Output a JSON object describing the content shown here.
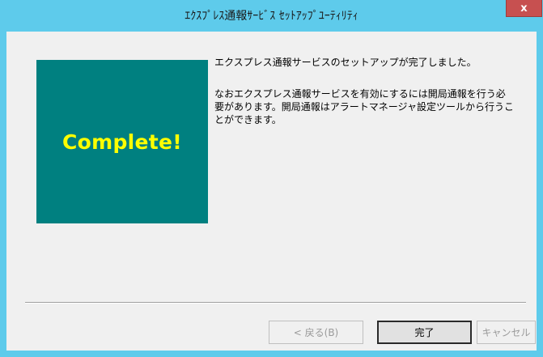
{
  "window": {
    "title": "ｴｸｽﾌﾟﾚｽ通報ｻｰﾋﾞｽ ｾｯﾄｱｯﾌﾟﾕｰﾃｨﾘﾃｨ",
    "close_label": "x"
  },
  "hero": {
    "text": "Complete!",
    "background_color": "#008080",
    "text_color": "#ffff00"
  },
  "message": {
    "line1": "エクスプレス通報サービスのセットアップが完了しました。",
    "paragraph2": "なおエクスプレス通報サービスを有効にするには開局通報を行う必\n要があります。開局通報はアラートマネージャ設定ツールから行うこ\nとができます。"
  },
  "buttons": {
    "back_label": "< 戻る(B)",
    "finish_label": "完了",
    "cancel_label": "キャンセル"
  },
  "colors": {
    "titlebar": "#5ecbeb",
    "close_button": "#c75050",
    "client_background": "#f0f0f0"
  }
}
